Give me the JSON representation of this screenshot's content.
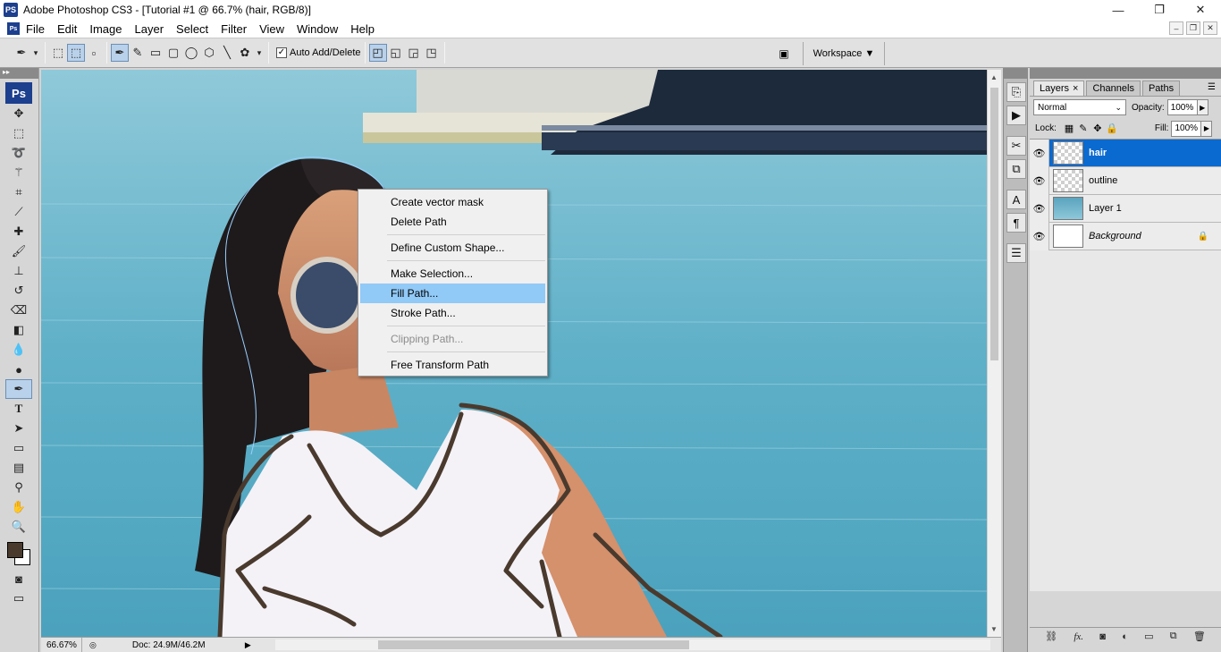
{
  "titlebar": {
    "app_icon": "PS",
    "title": "Adobe Photoshop CS3 - [Tutorial #1 @ 66.7% (hair, RGB/8)]",
    "minimize": "—",
    "maximize": "❐",
    "close": "✕"
  },
  "menubar": {
    "items": [
      "File",
      "Edit",
      "Image",
      "Layer",
      "Select",
      "Filter",
      "View",
      "Window",
      "Help"
    ],
    "mdi_min": "–",
    "mdi_restore": "❐",
    "mdi_close": "✕"
  },
  "optionsbar": {
    "auto_add_delete_label": "Auto Add/Delete",
    "auto_add_delete_checked": "✓",
    "workspace_label": "Workspace ▼"
  },
  "tools": {
    "badge": "Ps",
    "foreground_color": "#4a3a2e",
    "background_color": "#ffffff"
  },
  "context_menu": {
    "items": [
      {
        "label": "Create vector mask",
        "state": "normal"
      },
      {
        "label": "Delete Path",
        "state": "normal"
      },
      {
        "label": "Define Custom Shape...",
        "state": "normal"
      },
      {
        "label": "Make Selection...",
        "state": "normal"
      },
      {
        "label": "Fill Path...",
        "state": "highlighted"
      },
      {
        "label": "Stroke Path...",
        "state": "normal"
      },
      {
        "label": "Clipping Path...",
        "state": "disabled"
      },
      {
        "label": "Free Transform Path",
        "state": "normal"
      }
    ]
  },
  "statusbar": {
    "zoom": "66.67%",
    "doc_info": "Doc: 24.9M/46.2M"
  },
  "layers_panel": {
    "tabs": [
      "Layers",
      "Channels",
      "Paths"
    ],
    "tab_close": "×",
    "blend_mode": "Normal",
    "opacity_label": "Opacity:",
    "opacity_value": "100%",
    "lock_label": "Lock:",
    "fill_label": "Fill:",
    "fill_value": "100%",
    "layers": [
      {
        "name": "hair",
        "selected": true,
        "thumb": "transparent"
      },
      {
        "name": "outline",
        "selected": false,
        "thumb": "transparent"
      },
      {
        "name": "Layer 1",
        "selected": false,
        "thumb": "photo"
      },
      {
        "name": "Background",
        "selected": false,
        "thumb": "white",
        "locked": true
      }
    ]
  },
  "colors": {
    "selection_blue": "#0a6ad0",
    "menu_highlight": "#91c9f7",
    "ps_blue": "#1c3f8e"
  }
}
